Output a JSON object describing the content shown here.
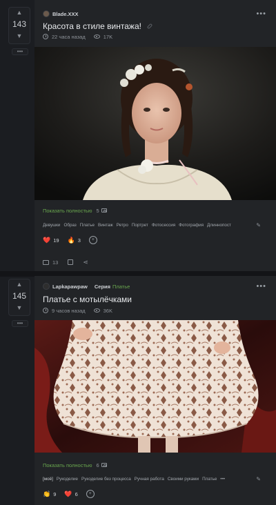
{
  "posts": [
    {
      "votes": "143",
      "author": "Blade.XXX",
      "title": "Красота в стиле винтажа!",
      "time": "22 часа назад",
      "views": "17K",
      "show_full": "Показать полностью",
      "photo_count": "5",
      "tags": [
        "Девушки",
        "Образ",
        "Платье",
        "Винтаж",
        "Ретро",
        "Портрет",
        "Фотосессия",
        "Фотография",
        "Длиннопост"
      ],
      "reactions": [
        {
          "emoji": "heart",
          "glyph": "❤️",
          "count": "19"
        },
        {
          "emoji": "fire",
          "glyph": "🔥",
          "count": "3"
        }
      ],
      "comments": "13"
    },
    {
      "votes": "145",
      "author": "Lapkapawpaw",
      "series_label": "Серия",
      "series_name": "Платье",
      "title": "Платье с мотылёчками",
      "time": "9 часов назад",
      "views": "36K",
      "show_full": "Показать полностью",
      "photo_count": "6",
      "tags": [
        "[моё]",
        "Рукоделие",
        "Рукоделие без процесса",
        "Ручная работа",
        "Своими руками",
        "Платье"
      ],
      "tags_more": "•••",
      "reactions": [
        {
          "emoji": "clap",
          "glyph": "👏",
          "count": "9"
        },
        {
          "emoji": "heart",
          "glyph": "❤️",
          "count": "6"
        }
      ]
    }
  ],
  "ui": {
    "more_dots": "•••",
    "vote_up": "▲",
    "vote_down": "▼",
    "vote_more": "•••",
    "add_reaction": "+",
    "edit_glyph": "✎",
    "share_glyph": "⋖"
  },
  "colors": {
    "background": "#1b1d21",
    "card": "#222427",
    "accent_green": "#6aa84f"
  }
}
